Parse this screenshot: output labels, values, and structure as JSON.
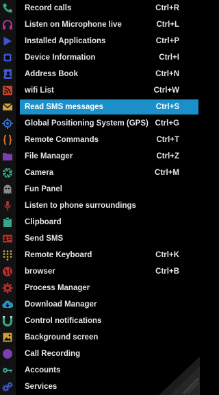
{
  "menu": {
    "items": [
      {
        "label": "Record calls",
        "shortcut": "Ctrl+R",
        "icon": "phone-icon",
        "color": "#3aa58a"
      },
      {
        "label": "Listen on Microphone live",
        "shortcut": "Ctrl+L",
        "icon": "headphones-icon",
        "color": "#b02fa3"
      },
      {
        "label": "Installed Applications",
        "shortcut": "Ctrl+P",
        "icon": "play-store-icon",
        "color": "#3d56c8"
      },
      {
        "label": "Device Information",
        "shortcut": "Ctrl+I",
        "icon": "chip-icon",
        "color": "#3d56c8"
      },
      {
        "label": "Address Book",
        "shortcut": "Ctrl+N",
        "icon": "contact-book-icon",
        "color": "#3d56c8"
      },
      {
        "label": "wifi List",
        "shortcut": "Ctrl+W",
        "icon": "rss-icon",
        "color": "#c0462f"
      },
      {
        "label": "Read SMS  messages",
        "shortcut": "Ctrl+S",
        "icon": "envelope-icon",
        "color": "#c9a13a",
        "selected": true
      },
      {
        "label": "Global Positioning System (GPS)",
        "shortcut": "Ctrl+G",
        "icon": "crosshair-icon",
        "color": "#2f6fd0"
      },
      {
        "label": "Remote Commands",
        "shortcut": "Ctrl+T",
        "icon": "code-braces-icon",
        "color": "#e0762a"
      },
      {
        "label": "File Manager",
        "shortcut": "Ctrl+Z",
        "icon": "folder-icon",
        "color": "#7a3fb0"
      },
      {
        "label": "Camera",
        "shortcut": "Ctrl+M",
        "icon": "aperture-icon",
        "color": "#3aa58a"
      },
      {
        "label": "Fun Panel",
        "shortcut": "",
        "icon": "ghost-icon",
        "color": "#8a8a8a"
      },
      {
        "label": "Listen to phone surroundings",
        "shortcut": "",
        "icon": "microphone-icon",
        "color": "#b0302f"
      },
      {
        "label": "Clipboard",
        "shortcut": "",
        "icon": "clipboard-icon",
        "color": "#3aa58a"
      },
      {
        "label": "Send SMS",
        "shortcut": "",
        "icon": "contact-card-icon",
        "color": "#b0302f"
      },
      {
        "label": "Remote Keyboard",
        "shortcut": "Ctrl+K",
        "icon": "keypad-icon",
        "color": "#c9a13a"
      },
      {
        "label": "browser",
        "shortcut": "Ctrl+B",
        "icon": "globe-icon",
        "color": "#b0302f"
      },
      {
        "label": "Process Manager",
        "shortcut": "",
        "icon": "gear-icon",
        "color": "#b0302f"
      },
      {
        "label": "Download Manager",
        "shortcut": "",
        "icon": "cloud-download-icon",
        "color": "#2f8fc0"
      },
      {
        "label": "Control notifications",
        "shortcut": "",
        "icon": "magnet-icon",
        "color": "#3aa58a"
      },
      {
        "label": "Background screen",
        "shortcut": "",
        "icon": "image-icon",
        "color": "#c9a13a"
      },
      {
        "label": "Call Recording",
        "shortcut": "",
        "icon": "circle-icon",
        "color": "#7a3fb0"
      },
      {
        "label": "Accounts",
        "shortcut": "",
        "icon": "key-icon",
        "color": "#3aa58a"
      },
      {
        "label": "Services",
        "shortcut": "",
        "icon": "gears-icon",
        "color": "#3d56c8"
      }
    ]
  },
  "colors": {
    "background": "#000000",
    "icon_strip": "#121212",
    "text": "#e6e6e6",
    "highlight": "#1a8fc9"
  }
}
